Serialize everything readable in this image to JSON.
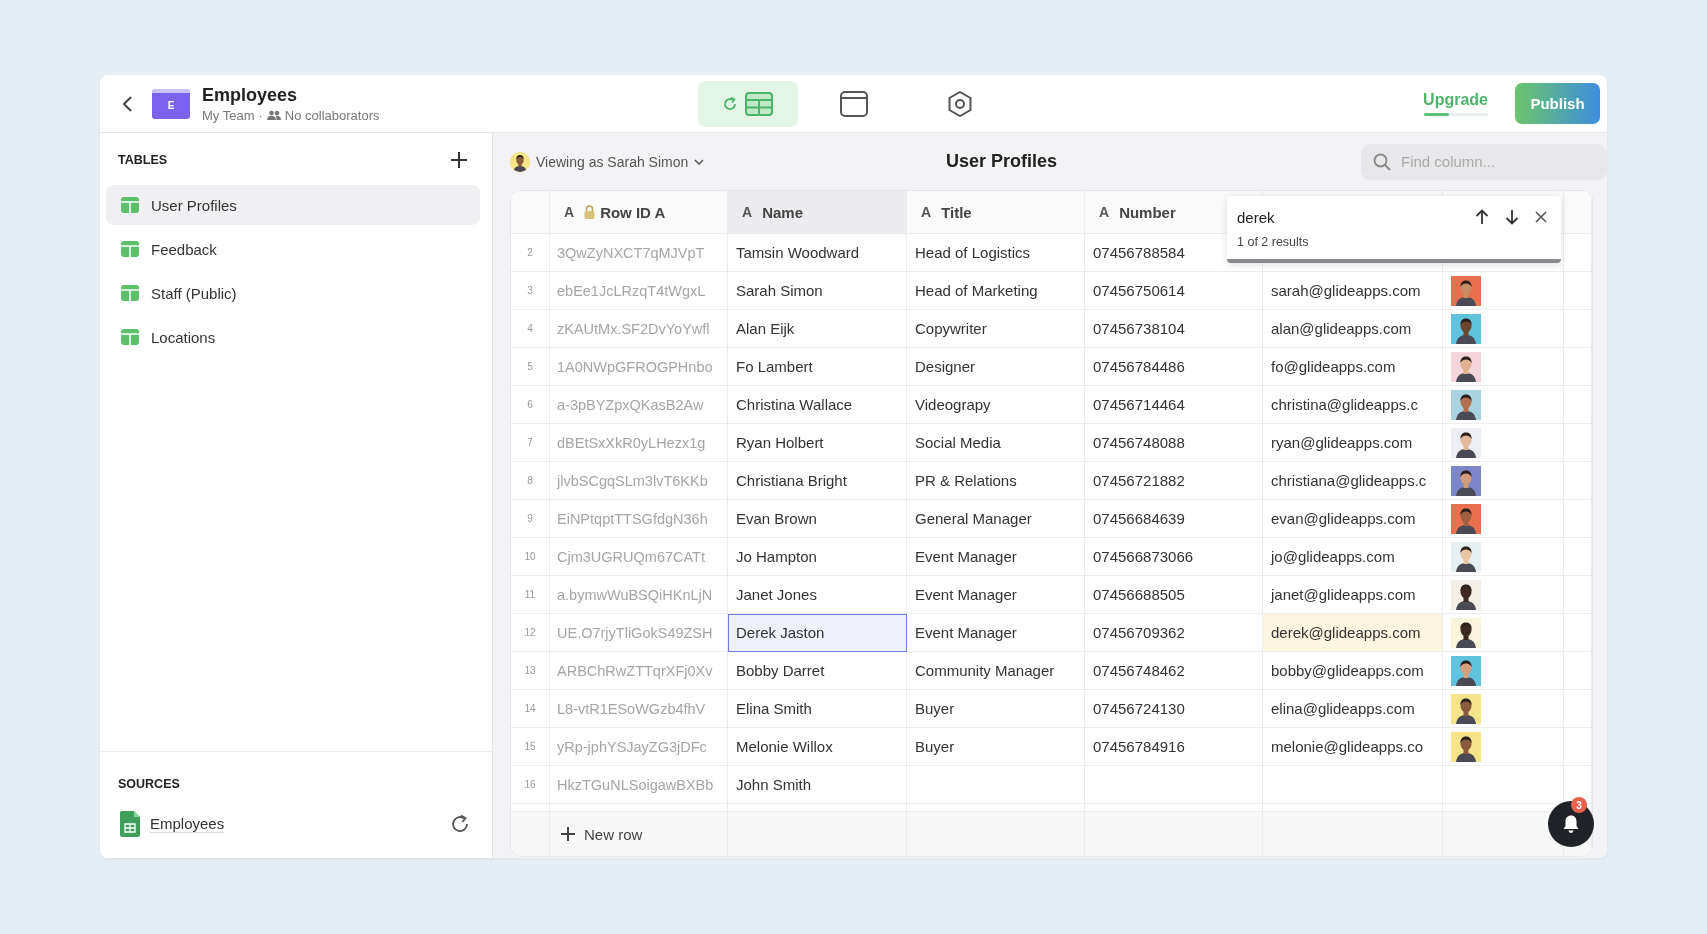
{
  "header": {
    "app_icon_letter": "E",
    "title": "Employees",
    "team": "My Team",
    "separator": "·",
    "collaborators": "No collaborators",
    "tabs": [
      {
        "kind": "data",
        "selected": true
      },
      {
        "kind": "layout",
        "selected": false
      },
      {
        "kind": "settings",
        "selected": false
      }
    ],
    "upgrade": {
      "label": "Upgrade",
      "level": 0.4
    },
    "publish": "Publish"
  },
  "sidebar": {
    "tables_heading": "TABLES",
    "tables": [
      {
        "label": "User Profiles",
        "selected": true
      },
      {
        "label": "Feedback",
        "selected": false
      },
      {
        "label": "Staff (Public)",
        "selected": false
      },
      {
        "label": "Locations",
        "selected": false
      }
    ],
    "sources_heading": "SOURCES",
    "sources": [
      {
        "label": "Employees"
      }
    ]
  },
  "toolbar": {
    "viewing_as": "Viewing as Sarah Simon",
    "title": "User Profiles",
    "search": {
      "placeholder": "Find column..."
    }
  },
  "table": {
    "columns": [
      {
        "type_glyph": "A",
        "label": "Row ID A",
        "locked": true,
        "selected": false
      },
      {
        "type_glyph": "A",
        "label": "Name",
        "locked": false,
        "selected": true
      },
      {
        "type_glyph": "A",
        "label": "Title",
        "locked": false,
        "selected": false
      },
      {
        "type_glyph": "A",
        "label": "Number",
        "locked": false,
        "selected": false
      }
    ],
    "rows": [
      {
        "number": "2",
        "row_id": "3QwZyNXCT7qMJVpT",
        "name": "Tamsin Woodward",
        "title": "Head of Logistics",
        "phone": "07456788584",
        "name_selected": false
      },
      {
        "number": "3",
        "row_id": "ebEe1JcLRzqT4tWgxL",
        "name": "Sarah Simon",
        "title": "Head of Marketing",
        "phone": "07456750614",
        "email": "sarah@glideapps.com",
        "name_selected": false,
        "email_match": false
      },
      {
        "number": "4",
        "row_id": "zKAUtMx.SF2DvYoYwfl",
        "name": "Alan Eijk",
        "title": "Copywriter",
        "phone": "07456738104",
        "email": "alan@glideapps.com",
        "name_selected": false,
        "email_match": false
      },
      {
        "number": "5",
        "row_id": "1A0NWpGFROGPHnbo",
        "name": "Fo Lambert",
        "title": "Designer",
        "phone": "07456784486",
        "email": "fo@glideapps.com",
        "name_selected": false,
        "email_match": false
      },
      {
        "number": "6",
        "row_id": "a-3pBYZpxQKasB2Aw",
        "name": "Christina Wallace",
        "title": "Videograpy",
        "phone": "07456714464",
        "email": "christina@glideapps.c",
        "name_selected": false,
        "email_match": false
      },
      {
        "number": "7",
        "row_id": "dBEtSxXkR0yLHezx1g",
        "name": "Ryan Holbert",
        "title": "Social Media",
        "phone": "07456748088",
        "email": "ryan@glideapps.com",
        "name_selected": false,
        "email_match": false
      },
      {
        "number": "8",
        "row_id": "jlvbSCgqSLm3lvT6KKb",
        "name": "Christiana Bright",
        "title": "PR & Relations",
        "phone": "07456721882",
        "email": "christiana@glideapps.c",
        "name_selected": false,
        "email_match": false
      },
      {
        "number": "9",
        "row_id": "EiNPtqptTTSGfdgN36h",
        "name": "Evan Brown",
        "title": "General Manager",
        "phone": "07456684639",
        "email": "evan@glideapps.com",
        "name_selected": false,
        "email_match": false
      },
      {
        "number": "10",
        "row_id": "Cjm3UGRUQm67CATt",
        "name": "Jo Hampton",
        "title": "Event Manager",
        "phone": "074566873066",
        "email": "jo@glideapps.com",
        "name_selected": false,
        "email_match": false
      },
      {
        "number": "11",
        "row_id": "a.bymwWuBSQiHKnLjN",
        "name": "Janet Jones",
        "title": "Event Manager",
        "phone": "07456688505",
        "email": "janet@glideapps.com",
        "name_selected": false,
        "email_match": false
      },
      {
        "number": "12",
        "row_id": "UE.O7rjyTliGokS49ZSH",
        "name": "Derek Jaston",
        "title": "Event Manager",
        "phone": "07456709362",
        "email": "derek@glideapps.com",
        "name_selected": true,
        "email_match": true
      },
      {
        "number": "13",
        "row_id": "ARBChRwZTTqrXFj0Xv",
        "name": "Bobby Darret",
        "title": "Community Manager",
        "phone": "07456748462",
        "email": "bobby@glideapps.com",
        "name_selected": false,
        "email_match": false
      },
      {
        "number": "14",
        "row_id": "L8-vtR1ESoWGzb4fhV",
        "name": "Elina Smith",
        "title": "Buyer",
        "phone": "07456724130",
        "email": "elina@glideapps.com",
        "name_selected": false,
        "email_match": false
      },
      {
        "number": "15",
        "row_id": "yRp-jphYSJayZG3jDFc",
        "name": "Melonie Willox",
        "title": "Buyer",
        "phone": "07456784916",
        "email": "melonie@glideapps.co",
        "name_selected": false,
        "email_match": false
      },
      {
        "number": "16",
        "row_id": "HkzTGuNLSoigawBXBb",
        "name": "John Smith",
        "name_selected": false
      }
    ],
    "new_row": "New row"
  },
  "find": {
    "value": "derek",
    "result": "1 of 2 results"
  },
  "notifications": {
    "count": "3"
  }
}
